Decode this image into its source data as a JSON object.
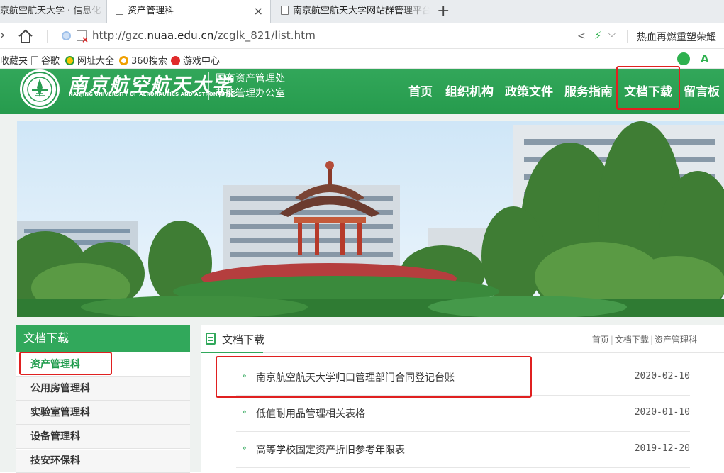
{
  "browser": {
    "tabs": [
      {
        "label": "京航空航天大学 · 信息化"
      },
      {
        "label": "资产管理科",
        "close": "×"
      },
      {
        "label": "南京航空航天大学网站群管理平台"
      }
    ],
    "new_tab": "+",
    "url_prefix": "http://gzc.",
    "url_host": "nuaa.edu.cn",
    "url_path": "/zcglk_821/list.htm",
    "hot_search": "热血再燃重塑荣耀",
    "bookmarks": [
      "收藏夹",
      "谷歌",
      "网址大全",
      "360搜索",
      "游戏中心"
    ]
  },
  "site": {
    "logo_cn": "南京航空航天大学",
    "logo_en": "NANJING UNIVERSITY OF AERONAUTICS AND ASTRONAUTICS",
    "dept_line1": "国有资产管理处",
    "dept_line2": "节能管理办公室",
    "nav": [
      "首页",
      "组织机构",
      "政策文件",
      "服务指南",
      "文档下载",
      "留言板"
    ]
  },
  "sidebar": {
    "title": "文档下载",
    "items": [
      "资产管理科",
      "公用房管理科",
      "实验室管理科",
      "设备管理科",
      "技安环保科"
    ],
    "active_index": 0
  },
  "main": {
    "title": "文档下载",
    "breadcrumb": [
      "首页",
      "文档下载",
      "资产管理科"
    ],
    "breadcrumb_sep": "|",
    "bullet": "»",
    "rows": [
      {
        "title": "南京航空航天大学归口管理部门合同登记台账",
        "date": "2020-02-10"
      },
      {
        "title": "低值耐用品管理相关表格",
        "date": "2020-01-10"
      },
      {
        "title": "高等学校固定资产折旧参考年限表",
        "date": "2019-12-20"
      }
    ]
  },
  "colors": {
    "brand_green": "#31a85b",
    "highlight_red": "#e02020"
  }
}
